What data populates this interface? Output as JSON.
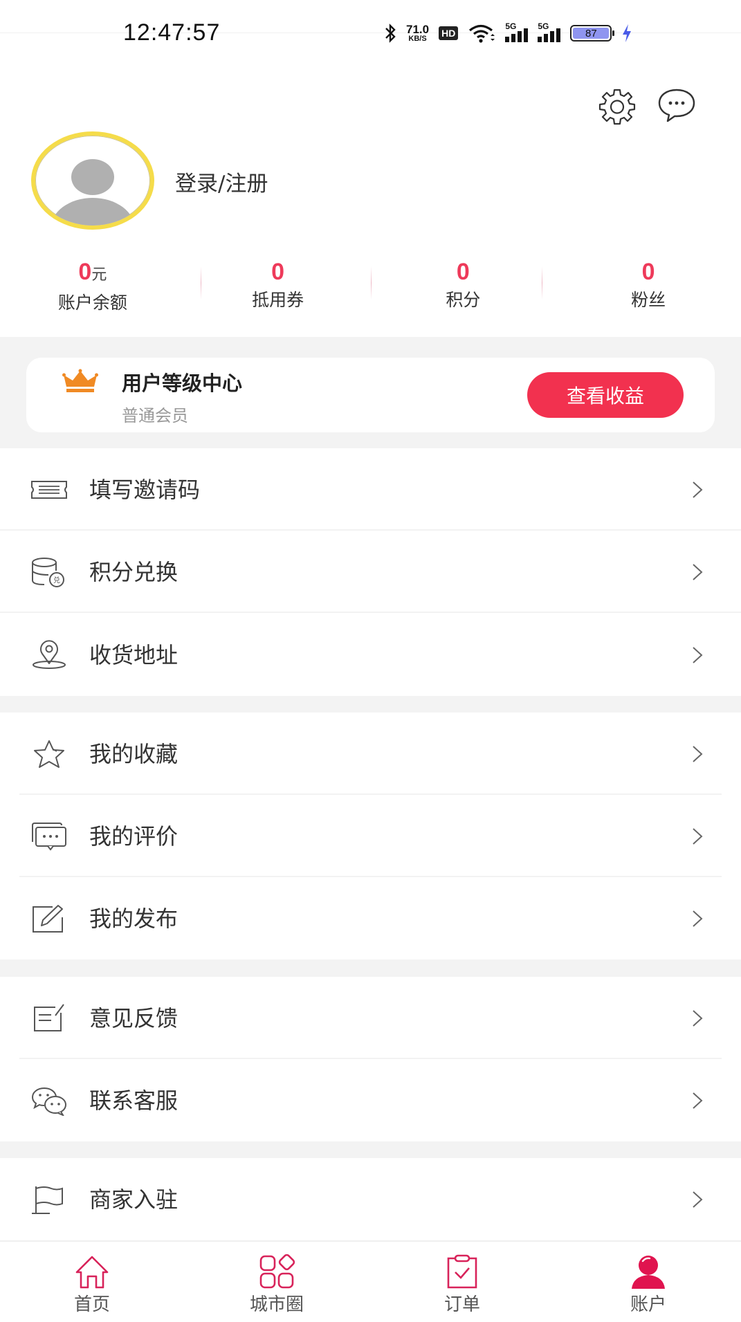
{
  "status_bar": {
    "time": "12:47:57",
    "net_speed_value": "71.0",
    "net_speed_unit": "KB/S",
    "hd_badge": "HD",
    "signal_1_label": "5G",
    "signal_2_label": "5G",
    "battery_level": "87",
    "icons": [
      "bluetooth-icon",
      "wifi-icon",
      "signal-icon",
      "battery-icon",
      "charging-icon"
    ]
  },
  "header": {
    "settings_icon": "gear-icon",
    "message_icon": "chat-bubble-icon"
  },
  "profile": {
    "avatar": "default-avatar",
    "login_text": "登录/注册"
  },
  "stats": [
    {
      "value": "0",
      "unit": "元",
      "label": "账户余额"
    },
    {
      "value": "0",
      "unit": "",
      "label": "抵用券"
    },
    {
      "value": "0",
      "unit": "",
      "label": "积分"
    },
    {
      "value": "0",
      "unit": "",
      "label": "粉丝"
    }
  ],
  "level_card": {
    "icon": "crown-icon",
    "title": "用户等级中心",
    "subtitle": "普通会员",
    "button_label": "查看收益"
  },
  "menu_groups": [
    {
      "items": [
        {
          "icon": "ticket-icon",
          "label": "填写邀请码"
        },
        {
          "icon": "points-exchange-icon",
          "label": "积分兑换"
        },
        {
          "icon": "location-icon",
          "label": "收货地址"
        }
      ]
    },
    {
      "items": [
        {
          "icon": "star-icon",
          "label": "我的收藏"
        },
        {
          "icon": "comment-icon",
          "label": "我的评价"
        },
        {
          "icon": "edit-icon",
          "label": "我的发布"
        }
      ]
    },
    {
      "items": [
        {
          "icon": "feedback-icon",
          "label": "意见反馈"
        },
        {
          "icon": "wechat-icon",
          "label": "联系客服"
        }
      ]
    },
    {
      "items": [
        {
          "icon": "flag-icon",
          "label": "商家入驻"
        }
      ]
    }
  ],
  "bottom_nav": {
    "items": [
      {
        "icon": "home-icon",
        "label": "首页",
        "active": false
      },
      {
        "icon": "city-circle-icon",
        "label": "城市圈",
        "active": false
      },
      {
        "icon": "order-icon",
        "label": "订单",
        "active": false
      },
      {
        "icon": "account-icon",
        "label": "账户",
        "active": true
      }
    ]
  },
  "colors": {
    "accent": "#f2314f",
    "stat_number": "#ee3a5a",
    "nav_icon": "#d8235a",
    "avatar_ring": "#f5dc4a",
    "crown": "#f08a24",
    "section_gray": "#f3f3f3",
    "battery_fill": "#8f95f0",
    "charging": "#4a5ce8"
  }
}
